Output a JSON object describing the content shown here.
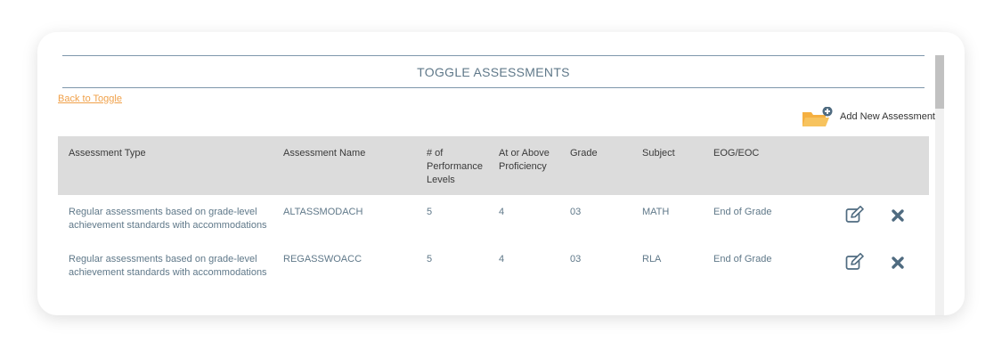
{
  "page": {
    "title": "TOGGLE ASSESSMENTS",
    "back_link": "Back to Toggle",
    "add_button_label": "Add New Assessment"
  },
  "colors": {
    "accent_link": "#f0a14a",
    "header_bg": "#dcdcdc",
    "body_text": "#5f7889",
    "folder": "#f5b041",
    "action_icon": "#4f6b80"
  },
  "table": {
    "columns": [
      "Assessment Type",
      "Assessment Name",
      "# of Performance Levels",
      "At or Above Proficiency",
      "Grade",
      "Subject",
      "EOG/EOC"
    ],
    "rows": [
      {
        "type": "Regular assessments based on grade-level achievement standards with accommodations",
        "name": "ALTASSMODACH",
        "levels": "5",
        "proficiency": "4",
        "grade": "03",
        "subject": "MATH",
        "eog": "End of Grade"
      },
      {
        "type": "Regular assessments based on grade-level achievement standards with accommodations",
        "name": "REGASSWOACC",
        "levels": "5",
        "proficiency": "4",
        "grade": "03",
        "subject": "RLA",
        "eog": "End of Grade"
      }
    ]
  },
  "icons": {
    "add": "folder-add-icon",
    "edit": "edit-icon",
    "delete": "delete-x-icon"
  }
}
